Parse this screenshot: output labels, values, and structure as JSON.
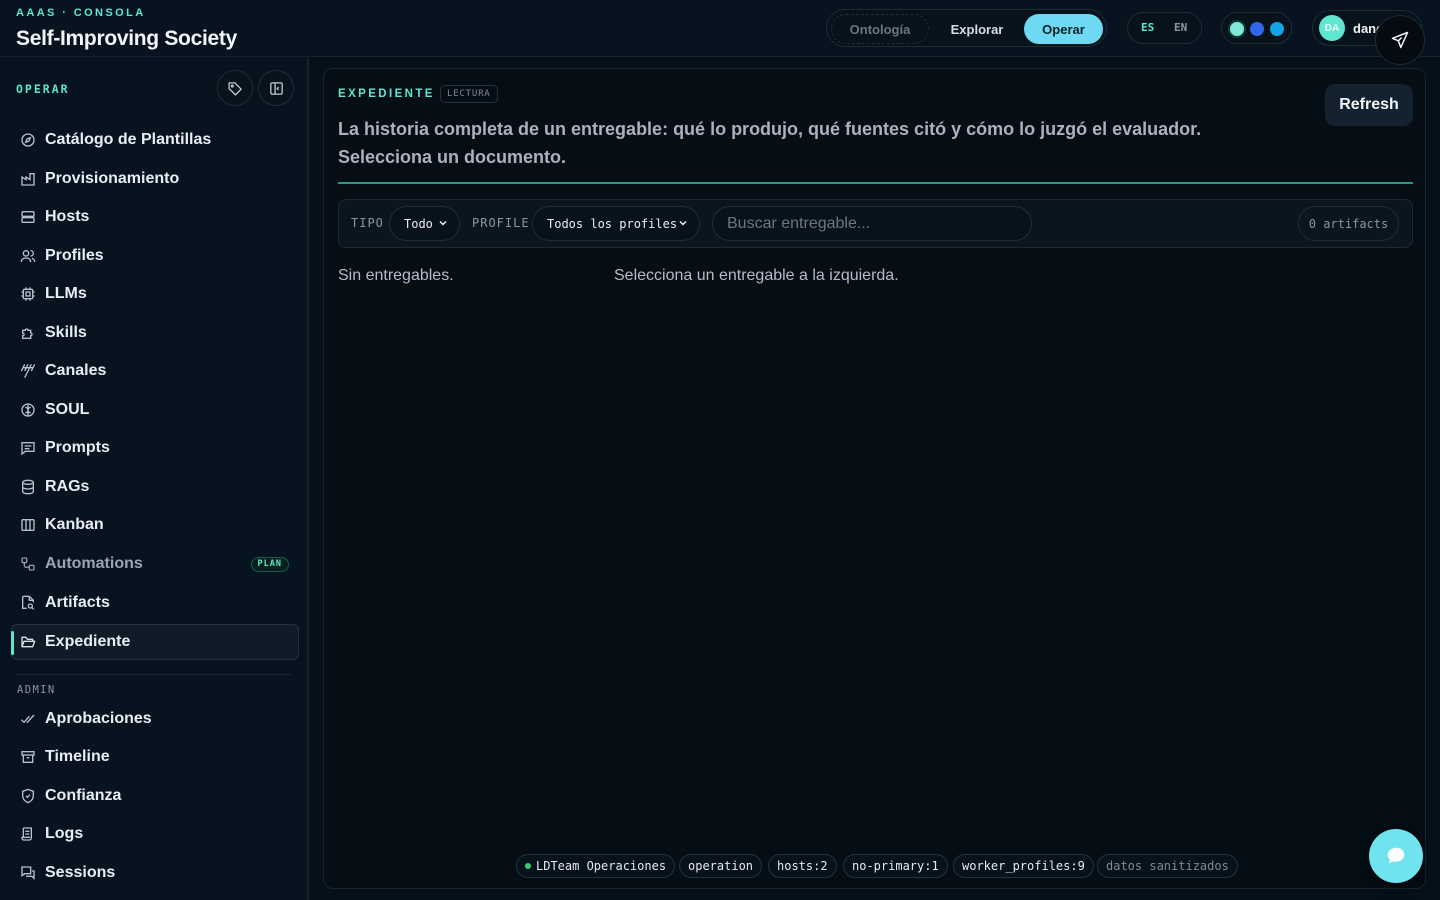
{
  "header": {
    "kicker": "AAAS · CONSOLA",
    "title": "Self-Improving Society",
    "segments": [
      "Ontología",
      "Explorar",
      "Operar"
    ],
    "active_segment": "Operar",
    "languages": [
      "ES",
      "EN"
    ],
    "active_language": "ES",
    "theme_colors": [
      "#7fe8d8",
      "#2f67e8",
      "#13a3e6"
    ],
    "user": {
      "initials": "DA",
      "name": "dane"
    }
  },
  "sidebar": {
    "section": "OPERAR",
    "items": [
      {
        "label": "Catálogo de Plantillas",
        "icon": "compass-icon"
      },
      {
        "label": "Provisionamiento",
        "icon": "factory-icon"
      },
      {
        "label": "Hosts",
        "icon": "server-icon"
      },
      {
        "label": "Profiles",
        "icon": "users-icon"
      },
      {
        "label": "LLMs",
        "icon": "cpu-icon"
      },
      {
        "label": "Skills",
        "icon": "puzzle-icon"
      },
      {
        "label": "Canales",
        "icon": "antenna-icon"
      },
      {
        "label": "SOUL",
        "icon": "brain-icon"
      },
      {
        "label": "Prompts",
        "icon": "message-icon"
      },
      {
        "label": "RAGs",
        "icon": "database-icon"
      },
      {
        "label": "Kanban",
        "icon": "columns-icon"
      },
      {
        "label": "Automations",
        "icon": "workflow-icon",
        "badge": "PLAN"
      },
      {
        "label": "Artifacts",
        "icon": "file-search-icon"
      },
      {
        "label": "Expediente",
        "icon": "folder-open-icon",
        "active": true
      }
    ],
    "admin_section": "ADMIN",
    "admin_items": [
      {
        "label": "Aprobaciones",
        "icon": "check-check-icon"
      },
      {
        "label": "Timeline",
        "icon": "archive-icon"
      },
      {
        "label": "Confianza",
        "icon": "shield-icon"
      },
      {
        "label": "Logs",
        "icon": "scroll-icon"
      },
      {
        "label": "Sessions",
        "icon": "chat-icon"
      }
    ]
  },
  "main": {
    "kicker": "EXPEDIENTE",
    "badge": "LECTURA",
    "description": "La historia completa de un entregable: qué lo produjo, qué fuentes citó y cómo lo juzgó el evaluador. Selecciona un documento.",
    "refresh_label": "Refresh",
    "filters": {
      "tipo_label": "TIPO",
      "tipo_value": "Todo",
      "profile_label": "PROFILE",
      "profile_value": "Todos los profiles",
      "search_placeholder": "Buscar entregable...",
      "count": "0 artifacts"
    },
    "empty_list": "Sin entregables.",
    "empty_detail": "Selecciona un entregable a la izquierda."
  },
  "footer_chips": [
    "LDTeam Operaciones",
    "operation",
    "hosts:2",
    "no-primary:1",
    "worker_profiles:9",
    "datos sanitizados"
  ]
}
